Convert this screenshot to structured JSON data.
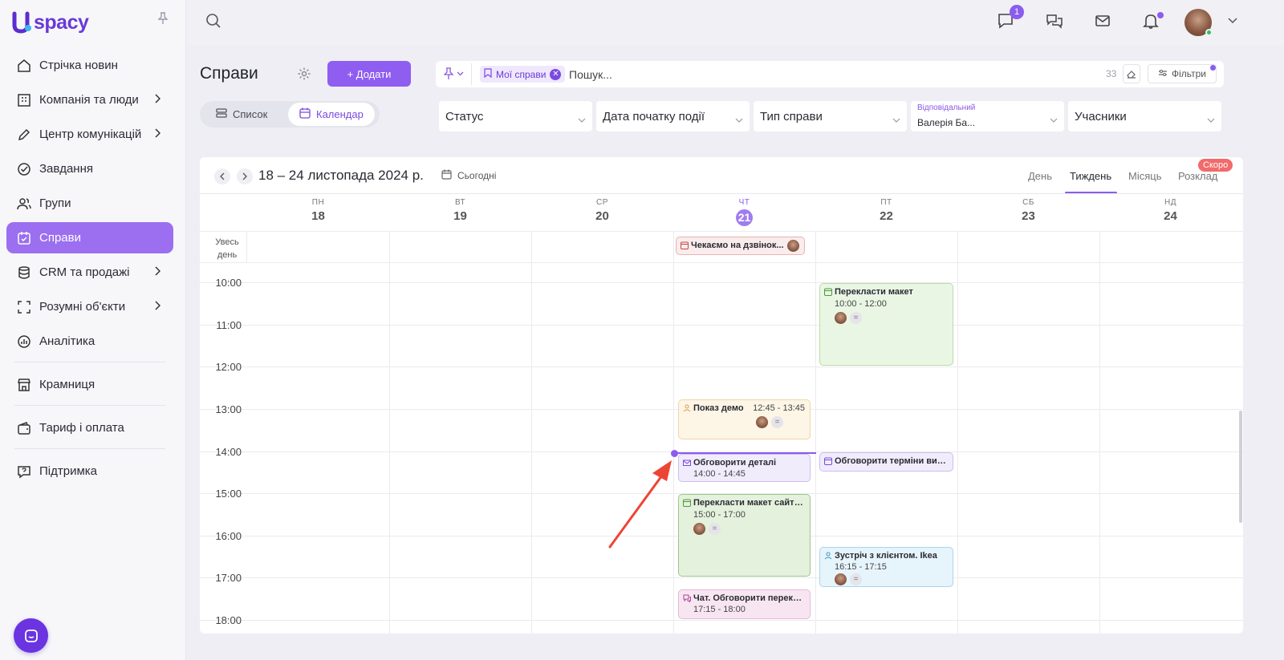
{
  "app": {
    "name": "spacy"
  },
  "sidebar": {
    "items": [
      {
        "label": "Стрічка новин",
        "icon": "home-icon",
        "chevron": false
      },
      {
        "label": "Компанія та люди",
        "icon": "company-icon",
        "chevron": true
      },
      {
        "label": "Центр комунікацій",
        "icon": "edit-icon",
        "chevron": true
      },
      {
        "label": "Завдання",
        "icon": "check-circle-icon",
        "chevron": false
      },
      {
        "label": "Групи",
        "icon": "users-icon",
        "chevron": false
      },
      {
        "label": "Справи",
        "icon": "calendar-check-icon",
        "chevron": false,
        "active": true
      },
      {
        "label": "CRM та продажі",
        "icon": "database-icon",
        "chevron": true
      },
      {
        "label": "Розумні об'єкти",
        "icon": "scan-icon",
        "chevron": true
      },
      {
        "label": "Аналітика",
        "icon": "chart-icon",
        "chevron": false
      },
      {
        "label": "Крамниця",
        "icon": "store-icon",
        "chevron": false
      },
      {
        "label": "Тариф і оплата",
        "icon": "wallet-icon",
        "chevron": false
      },
      {
        "label": "Підтримка",
        "icon": "help-icon",
        "chevron": false
      }
    ]
  },
  "topbar": {
    "messages_badge": "1"
  },
  "header": {
    "title": "Справи",
    "add_label": "+ Додати",
    "view_list": "Список",
    "view_calendar": "Календар"
  },
  "filters": {
    "tag": "Мої справи",
    "search_placeholder": "Пошук...",
    "count": "33",
    "filters_label": "Фільтри",
    "status": "Статус",
    "start_date": "Дата початку події",
    "type": "Тип справи",
    "responsible_label": "Відповідальний",
    "responsible_value": "Валерія Ба...",
    "participants": "Учасники"
  },
  "calendar": {
    "range": "18 – 24 листопада 2024 р.",
    "today": "Сьогодні",
    "views": {
      "day": "День",
      "week": "Тиждень",
      "month": "Місяць",
      "schedule": "Розклад",
      "soon": "Скоро"
    },
    "allday_label": "Увесь день",
    "days": [
      {
        "name": "ПН",
        "date": "18"
      },
      {
        "name": "ВТ",
        "date": "19"
      },
      {
        "name": "СР",
        "date": "20"
      },
      {
        "name": "ЧТ",
        "date": "21"
      },
      {
        "name": "ПТ",
        "date": "22"
      },
      {
        "name": "СБ",
        "date": "23"
      },
      {
        "name": "НД",
        "date": "24"
      }
    ],
    "hours": [
      "10:00",
      "11:00",
      "12:00",
      "13:00",
      "14:00",
      "15:00",
      "16:00",
      "17:00",
      "18:00"
    ],
    "events": {
      "allday": {
        "title": "Чекаємо на дзвінок..."
      },
      "e1": {
        "title": "Перекласти макет",
        "time": "10:00 - 12:00"
      },
      "e2": {
        "title": "Показ демо",
        "time": "12:45 - 13:45"
      },
      "e3": {
        "title": "Обговорити деталі",
        "time": "14:00 - 14:45"
      },
      "e4": {
        "title": "Обговорити терміни вик..."
      },
      "e5": {
        "title": "Перекласти макет сайту...",
        "time": "15:00 - 17:00"
      },
      "e6": {
        "title": "Зустріч з клієнтом. Ikea",
        "time": "16:15 - 17:15"
      },
      "e7": {
        "title": "Чат. Обговорити перекл...",
        "time": "17:15 - 18:00"
      }
    },
    "colors": {
      "accent": "#8b5cf0",
      "green": "#eaf6e4",
      "orange": "#fdf5e6",
      "lavender": "#f1ecfb",
      "blue": "#e6f4fb",
      "pink": "#f7e6f2",
      "red": "#f9ecec"
    }
  }
}
